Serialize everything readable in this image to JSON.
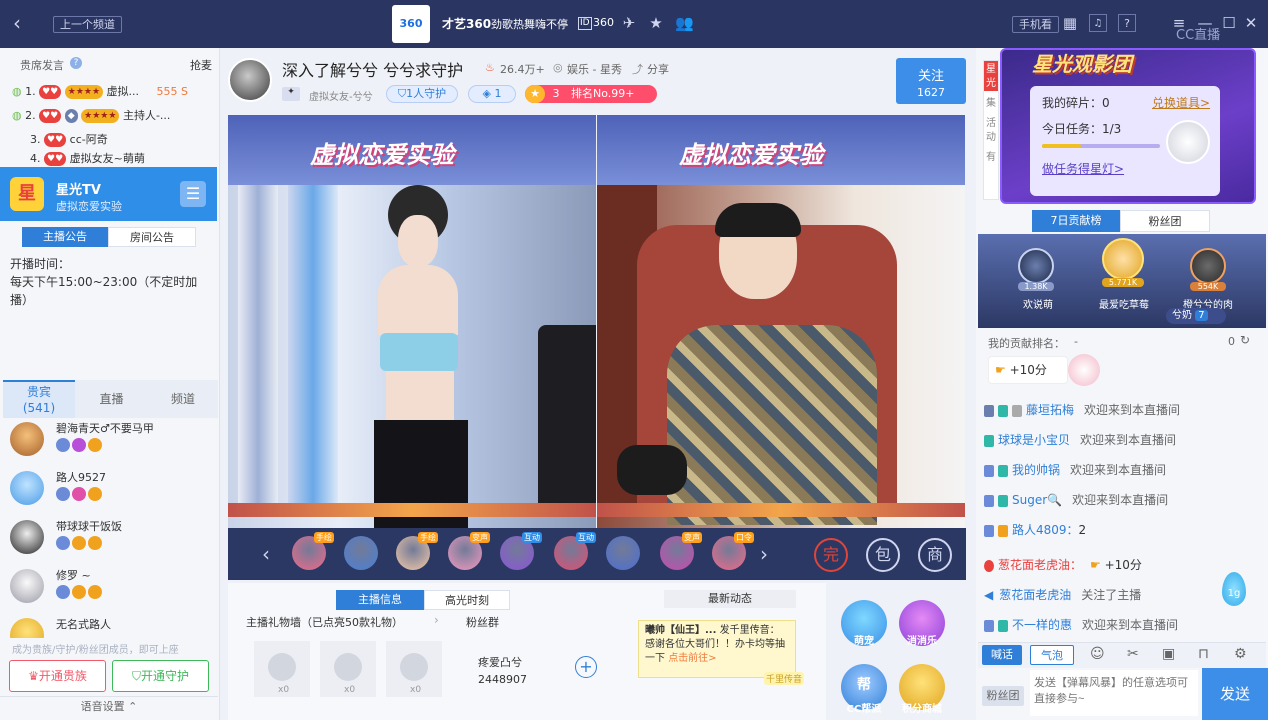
{
  "window": {
    "back_icon": "chevron-left-icon",
    "prev_channel": "上一个频道",
    "logo_text": "360",
    "channel_name": "才艺360",
    "channel_slogan": "劲歌热舞嗨不停",
    "room_id": "360",
    "phone_watch": "手机看",
    "cc_logo": "CC直播"
  },
  "left": {
    "header_title": "贵席发言",
    "header_action": "抢麦",
    "ranks": [
      {
        "num": "1.",
        "name": "虚拟...",
        "value": "555 S"
      },
      {
        "num": "2.",
        "name": "主持人-..."
      },
      {
        "num": "3.",
        "name": "cc-阿奇"
      },
      {
        "num": "4.",
        "name": "虚拟女友~萌萌"
      }
    ],
    "tv_title": "星光TV",
    "tv_subtitle": "虚拟恋爱实验",
    "tv_icon_text": "星",
    "notice_tabs": [
      "主播公告",
      "房间公告"
    ],
    "notice_text_1": "开播时间：",
    "notice_text_2": "每天下午15:00~23:00（不定时加播）",
    "member_tabs": [
      {
        "label": "贵宾",
        "count": "(541)"
      },
      {
        "label": "直播"
      },
      {
        "label": "频道"
      }
    ],
    "members": [
      {
        "name": "碧海青天♂不要马甲"
      },
      {
        "name": "路人9527"
      },
      {
        "name": "带球球干饭饭"
      },
      {
        "name": "修罗 ~"
      },
      {
        "name": "无名式路人"
      }
    ],
    "promo_text": "成为贵族/守护/粉丝团成员，即可上座",
    "btn_noble": "开通贵族",
    "btn_guard": "开通守护",
    "voice_settings": "语音设置"
  },
  "streamer": {
    "title": "深入了解兮兮 兮兮求守护",
    "heat": "26.4万+",
    "category": "娱乐 - 星秀",
    "share": "分享",
    "tag_name": "虚拟女友-兮兮",
    "guard": "1人守护",
    "fans": "1",
    "rank_level": "3",
    "rank_text": "排名No.99+",
    "follow_label": "关注",
    "follow_count": "1627",
    "banner_left": "虚拟恋爱实验",
    "banner_right": "虚拟恋爱实验"
  },
  "gifts": {
    "prev_icon": "chevron-left-icon",
    "next_icon": "chevron-right-icon",
    "items": [
      {
        "tag": "手绘",
        "color": "#f06a8a"
      },
      {
        "tag": "",
        "color": "#4a7fd6"
      },
      {
        "tag": "手绘",
        "color": "#f3c9a8"
      },
      {
        "tag": "变声",
        "color": "#f29ac0"
      },
      {
        "tag": "互动",
        "color": "#8b55d8"
      },
      {
        "tag": "互动",
        "color": "#e04f73"
      },
      {
        "tag": "",
        "color": "#4b6fd0"
      },
      {
        "tag": "变声",
        "color": "#c94bb0"
      },
      {
        "tag": "口令",
        "color": "#f06a8a"
      }
    ],
    "tool_icons": [
      "完",
      "包",
      "商"
    ]
  },
  "info": {
    "tabs": [
      "主播信息",
      "高光时刻"
    ],
    "gift_wall": "主播礼物墙（已点亮50款礼物）",
    "fan_group": "粉丝群",
    "gift_counts": [
      "x0",
      "x0",
      "x0"
    ],
    "fan_name": "疼爱凸兮",
    "fan_id": "2448907",
    "news_tab": "最新动态",
    "news_user": "曦帅【仙王】...",
    "news_text": "发千里传音：感谢各位大哥们！！办卡均等抽一下",
    "news_link": "点击前往>",
    "news_badge": "千里传音"
  },
  "apps": [
    {
      "label": "萌宠",
      "color": "#3a8ee6"
    },
    {
      "label": "消消乐",
      "color": "#a24fd8"
    },
    {
      "label": "CC帮派",
      "color": "#2f7fd8"
    },
    {
      "label": "积分商城",
      "color": "#f0b020"
    }
  ],
  "right": {
    "star_title": "星光观影团",
    "fragments_label": "我的碎片：0",
    "exchange": "兑换道具>",
    "task_label": "今日任务：1/3",
    "task_progress": 0.333,
    "task_link": "做任务得星灯>",
    "side_tabs": [
      "星光",
      "集",
      "活动",
      "有"
    ],
    "contrib_tabs": [
      "7日贡献榜",
      "粉丝团"
    ],
    "podium": [
      {
        "name": "欢说萌",
        "value": "1.38K"
      },
      {
        "name": "最爱吃草莓",
        "value": "5.771K"
      },
      {
        "name": "橙兮兮的肉",
        "value": "554K"
      }
    ],
    "fan_tag": "兮奶",
    "fan_tag_num": "7",
    "my_rank_label": "我的贡献排名：",
    "my_rank_value": "-",
    "my_rank_count": "0",
    "plus_points": "+10分",
    "chat": [
      {
        "user": "藤垣拓梅",
        "text": "欢迎来到本直播间"
      },
      {
        "user": "球球是小宝贝",
        "text": "欢迎来到本直播间"
      },
      {
        "user": "我的帅锅",
        "text": "欢迎来到本直播间"
      },
      {
        "user": "Suger🔍",
        "text": "欢迎来到本直播间"
      },
      {
        "user": "路人4809：",
        "text": "2"
      },
      {
        "user": "葱花面老虎油：",
        "text": "+10分"
      },
      {
        "user": "葱花面老虎油",
        "text": "关注了主播"
      },
      {
        "user": "不一样的惠",
        "text": "欢迎来到本直播间"
      }
    ],
    "drop_value": "1g",
    "input_tabs": [
      "喊话",
      "气泡"
    ],
    "fan_group_btn": "粉丝团",
    "input_placeholder": "发送【弹幕风暴】的任意选项可直接参与~",
    "send": "发送"
  }
}
